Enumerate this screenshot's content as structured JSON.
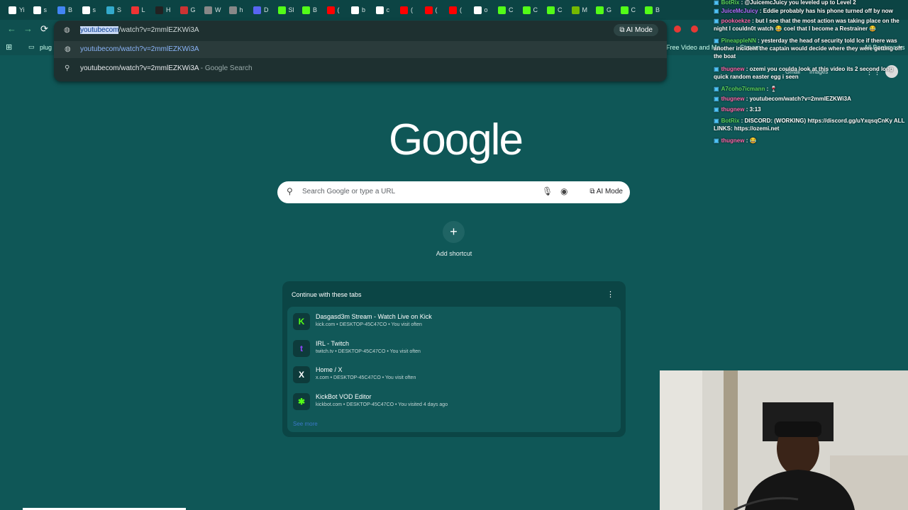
{
  "tabs": [
    {
      "label": "Yi",
      "icon": "white-square-icon",
      "color": "#ffffff"
    },
    {
      "label": "s",
      "icon": "google-icon",
      "color": "#ffffff"
    },
    {
      "label": "B",
      "icon": "docs-icon",
      "color": "#4285f4"
    },
    {
      "label": "s",
      "icon": "google-icon",
      "color": "#ffffff"
    },
    {
      "label": "S",
      "icon": "circle-icon",
      "color": "#33aacc"
    },
    {
      "label": "L",
      "icon": "dot-icon",
      "color": "#ee3333"
    },
    {
      "label": "H",
      "icon": "pinterest-icon",
      "color": "#222222"
    },
    {
      "label": "G",
      "icon": "red-square-icon",
      "color": "#cc3333"
    },
    {
      "label": "W",
      "icon": "globe-icon",
      "color": "#888888"
    },
    {
      "label": "h",
      "icon": "globe-icon",
      "color": "#888888"
    },
    {
      "label": "D",
      "icon": "discord-icon",
      "color": "#5865f2"
    },
    {
      "label": "Sl",
      "icon": "kick-icon",
      "color": "#53fc18"
    },
    {
      "label": "B",
      "icon": "kick-icon",
      "color": "#53fc18"
    },
    {
      "label": "(",
      "icon": "youtube-icon",
      "color": "#ff0000"
    },
    {
      "label": "b",
      "icon": "b-icon",
      "color": "#ffffff"
    },
    {
      "label": "c",
      "icon": "google-icon",
      "color": "#ffffff"
    },
    {
      "label": "(",
      "icon": "youtube-icon",
      "color": "#ff0000"
    },
    {
      "label": "(",
      "icon": "youtube-icon",
      "color": "#ff0000"
    },
    {
      "label": "(",
      "icon": "youtube-icon",
      "color": "#ff0000"
    },
    {
      "label": "o",
      "icon": "x-icon",
      "color": "#ffffff"
    },
    {
      "label": "C",
      "icon": "kickbot-icon",
      "color": "#53fc18"
    },
    {
      "label": "C",
      "icon": "kickbot-icon",
      "color": "#53fc18"
    },
    {
      "label": "C",
      "icon": "kickbot-icon",
      "color": "#53fc18"
    },
    {
      "label": "M",
      "icon": "nvidia-icon",
      "color": "#76b900"
    },
    {
      "label": "G",
      "icon": "kick-icon",
      "color": "#53fc18"
    },
    {
      "label": "C",
      "icon": "kick-icon",
      "color": "#53fc18"
    },
    {
      "label": "B",
      "icon": "kickbot-icon",
      "color": "#53fc18"
    }
  ],
  "omnibox": {
    "url_selected": "youtubecom",
    "url_rest": "/watch?v=2mmlEZKWi3A",
    "ai_mode": "AI Mode",
    "suggestions": [
      {
        "text": "youtubecom/watch?v=2mmlEZKWi3A",
        "suffix": ""
      },
      {
        "text": "youtubecom/watch?v=2mmlEZKWi3A",
        "suffix": " - Google Search"
      }
    ]
  },
  "bookmarks": {
    "first": "plug",
    "right_items": [
      "Free Video and Me...",
      "Stream",
      "All Bookmarks"
    ]
  },
  "ntp": {
    "logo": "Google",
    "search_placeholder": "Search Google or type a URL",
    "ai_mode": "AI Mode",
    "add_shortcut": "Add shortcut",
    "header_links": [
      "Gmail",
      "Images"
    ]
  },
  "continue_card": {
    "title": "Continue with these tabs",
    "see_more": "See more",
    "items": [
      {
        "title": "Dasgasd3m Stream - Watch Live on Kick",
        "meta": "kick.com • DESKTOP-45C47CO • You visit often",
        "icon": "K",
        "color": "#53fc18"
      },
      {
        "title": "IRL - Twitch",
        "meta": "twitch.tv • DESKTOP-45C47CO • You visit often",
        "icon": "t",
        "color": "#9146ff"
      },
      {
        "title": "Home / X",
        "meta": "x.com • DESKTOP-45C47CO • You visit often",
        "icon": "X",
        "color": "#ffffff"
      },
      {
        "title": "KickBot VOD Editor",
        "meta": "kickbot.com • DESKTOP-45C47CO • You visited 4 days ago",
        "icon": "✱",
        "color": "#53fc18"
      }
    ]
  },
  "chat": [
    {
      "user": "BotRix",
      "text": ": @JuicemcJuicy you leveled up to Level 2",
      "color": "#5bd45b"
    },
    {
      "user": "JuiceMcJuicy",
      "text": ": Eddie probably has his phone turned off by now",
      "color": "#b56cff"
    },
    {
      "user": "pookoekze",
      "text": ": but I see that the most action was taking place on the night I couldn0t watch 😂 coel that I become a Restrainer 😂",
      "color": "#ff66aa"
    },
    {
      "user": "PineappleNN",
      "text": ": yesterday the head of security told Ice if there was another incident the captain would decide where they were getting off the boat",
      "color": "#5bd45b"
    },
    {
      "user": "thugnew",
      "text": ": ozemi you coulda look at this video its 2 second long quick random easter egg i seen",
      "color": "#ff66aa"
    },
    {
      "user": "A7coho7icmann",
      "text": ": 🍷",
      "color": "#5bd45b"
    },
    {
      "user": "thugnew",
      "text": ": youtubecom/watch?v=2mmlEZKWi3A",
      "color": "#ff66aa"
    },
    {
      "user": "thugnew",
      "text": ": 3:13",
      "color": "#ff66aa"
    },
    {
      "user": "BotRix",
      "text": ": DISCORD: (WORKING) https://discord.gg/uYxqsqCnKy ALL LINKS: https://ozemi.net",
      "color": "#5bd45b"
    },
    {
      "user": "thugnew",
      "text": ": 😂",
      "color": "#ff66aa"
    }
  ]
}
